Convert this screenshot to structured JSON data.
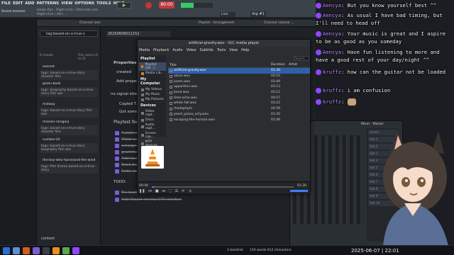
{
  "fl": {
    "menu": [
      "FILE",
      "EDIT",
      "ADD",
      "PATTERNS",
      "VIEW",
      "OPTIONS",
      "TOOLS",
      "HELP"
    ],
    "line2": "Resize browser",
    "hint": "Right-click / Alt+ ...",
    "hint2": "whale.flac - Right-click / Alternate size",
    "time": "80:00",
    "line_mode": "Line",
    "arp": "Arp #1",
    "bar2_items": [
      "Channel rack",
      "Playlist - Arrangement",
      "Channel volume ..."
    ],
    "mixer_title": "Mixer - Master",
    "mixer_slots": [
      "(none)",
      "Slot 1",
      "Slot 2",
      "Slot 3",
      "Slot 4",
      "Slot 5",
      "Slot 6",
      "Slot 7",
      "Slot 8",
      "Slot 9",
      "Slot 10"
    ]
  },
  "obsidian": {
    "search_value": "tag:based-on-a-true-s",
    "results_count": "6 results",
    "sort": "File name (A to Z)",
    "tab_title": "20250608011152",
    "results": [
      {
        "title": "everest",
        "tag": "tags: based-on-a-true-story disaster film"
      },
      {
        "title": "green-book",
        "tag": "tags: biography based-on-a-true-story film war"
      },
      {
        "title": "midway",
        "tag": "tags: based-on-a-true-story film war"
      },
      {
        "title": "mission-raniganj",
        "tag": "tags: based-on-a-true-story disaster film"
      },
      {
        "title": "number-24",
        "tag": "tags: based-on-a-true-story biography film war"
      },
      {
        "title": "the-boy-who-harnessed-the-wind",
        "tag": "tags: film drama based-on-a-true-story"
      }
    ],
    "note_lines": [
      "Properties",
      "created",
      "Add property",
      "no signal stream",
      "Copied T...",
      "Got some...",
      "Playtest feedback",
      "Puzzle co...",
      "Make ex...",
      "enlarge...",
      "gramma...",
      "Add text...",
      "Book bar...",
      "Soda can..."
    ],
    "todo_label": "TODO:",
    "todo_items": [
      "Fix loading ...",
      "Add Steam review CTA window"
    ],
    "status_left": "content",
    "backlinks": "1 backlink",
    "word_count": "110 words  612 characters"
  },
  "vlc": {
    "title": "artificial-gravity.wav - VLC media player",
    "menu": [
      "Media",
      "Playback",
      "Audio",
      "Video",
      "Subtitle",
      "Tools",
      "View",
      "Help"
    ],
    "search_placeholder": "Search",
    "sidebar_heading": "Playlist",
    "sidebar_items": [
      "Playlist [28...]",
      "Media Lib..."
    ],
    "my_computer": "My Computer",
    "computer_items": [
      "My Videos",
      "My Music",
      "My Pictures"
    ],
    "devices": "Devices",
    "device_items": [
      "Video capt...",
      "Discs",
      "Audio capt...",
      "Screen cap...",
      "MTP devices"
    ],
    "columns": [
      "Title",
      "Duration",
      "Artist"
    ],
    "tracks": [
      {
        "title": "artificial-gravity.wav",
        "duration": "01:30",
        "selected": true
      },
      {
        "title": "alone.wav",
        "duration": "02:03"
      },
      {
        "title": "poem.wav",
        "duration": "03:49"
      },
      {
        "title": "apparition.wav",
        "duration": "03:13"
      },
      {
        "title": "bend.wav",
        "duration": "03:12"
      },
      {
        "title": "time-echo.wav",
        "duration": "00:57"
      },
      {
        "title": "whale fall.wav",
        "duration": "03:22"
      },
      {
        "title": "rhodophyta",
        "duration": "04:59"
      },
      {
        "title": "poem_piano_only.wav",
        "duration": "01:20"
      },
      {
        "title": "escaping-the-horizon.wav",
        "duration": "01:46"
      }
    ],
    "elapsed": "00:40",
    "total": "01:30",
    "progress": 0.02
  },
  "chat": [
    {
      "user": "Aencya",
      "text": "But you know yourself best ^^"
    },
    {
      "user": "Aencya",
      "text": "As usual I have bad timing, but I'll need to head off"
    },
    {
      "user": "Aencya",
      "text": "Your music is great and I aspire to be as good as you someday"
    },
    {
      "user": "Aencya",
      "text": "Have fun listening to more and have a good rest of your day/night ^^"
    },
    {
      "user": "kruffz",
      "text": "how can the guitar not be loaded"
    },
    {
      "user": "kruffz",
      "text": "i am confusion"
    },
    {
      "user": "kruffz",
      "text": ""
    }
  ],
  "taskbar": {
    "clock": "2025-06-07 | 22:01"
  },
  "colors": {
    "chat_name": "#b98cff",
    "accent": "#7b5dd6",
    "fl_record": "#c43a3a",
    "vlc_select": "#2f5fa8"
  }
}
